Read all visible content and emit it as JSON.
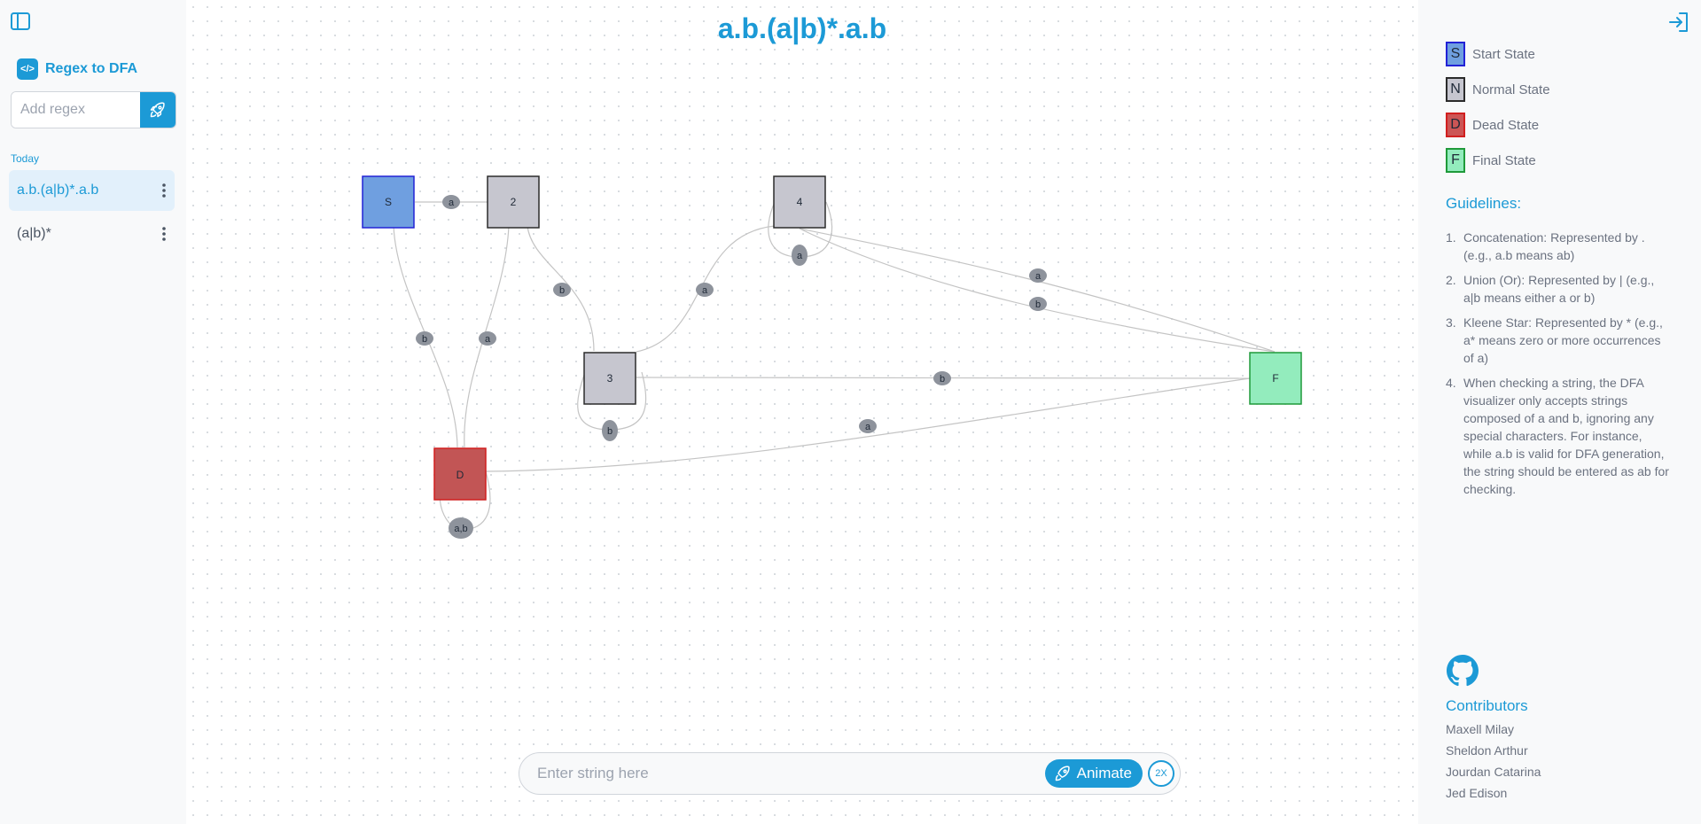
{
  "sidebar": {
    "app_name": "Regex to DFA",
    "logo_text": "</>",
    "regex_placeholder": "Add regex",
    "section_label": "Today",
    "history": [
      {
        "label": "a.b.(a|b)*.a.b",
        "active": true
      },
      {
        "label": "(a|b)*",
        "active": false
      }
    ]
  },
  "main": {
    "title": "a.b.(a|b)*.a.b",
    "string_placeholder": "Enter string here",
    "animate_label": "Animate",
    "speed_label": "2X"
  },
  "dfa": {
    "states": [
      {
        "id": "S",
        "type": "start"
      },
      {
        "id": "2",
        "type": "normal"
      },
      {
        "id": "4",
        "type": "normal"
      },
      {
        "id": "3",
        "type": "normal"
      },
      {
        "id": "D",
        "type": "dead"
      },
      {
        "id": "F",
        "type": "final"
      }
    ],
    "transitions": [
      {
        "from": "S",
        "to": "2",
        "label": "a"
      },
      {
        "from": "S",
        "to": "D",
        "label": "b"
      },
      {
        "from": "2",
        "to": "D",
        "label": "a"
      },
      {
        "from": "2",
        "to": "3",
        "label": "b"
      },
      {
        "from": "3",
        "to": "4",
        "label": "a"
      },
      {
        "from": "3",
        "to": "3",
        "label": "b"
      },
      {
        "from": "4",
        "to": "4",
        "label": "a"
      },
      {
        "from": "4",
        "to": "F",
        "label": "a"
      },
      {
        "from": "4",
        "to": "F",
        "label": "b"
      },
      {
        "from": "3",
        "to": "F",
        "label": "b"
      },
      {
        "from": "D",
        "to": "F",
        "label": "a"
      },
      {
        "from": "D",
        "to": "D",
        "label": "a,b"
      }
    ]
  },
  "legend": [
    {
      "letter": "S",
      "label": "Start State",
      "fill": "#6f9fe0",
      "border": "#2222d6"
    },
    {
      "letter": "N",
      "label": "Normal State",
      "fill": "#c6c6cf",
      "border": "#2b2b2b"
    },
    {
      "letter": "D",
      "label": "Dead State",
      "fill": "#cc5555",
      "border": "#d11f1f"
    },
    {
      "letter": "F",
      "label": "Final State",
      "fill": "#93ecbd",
      "border": "#1f9a3a"
    }
  ],
  "guidelines": {
    "title": "Guidelines:",
    "items": [
      {
        "num": "1.",
        "text": "Concatenation: Represented by . (e.g., a.b means ab)"
      },
      {
        "num": "2.",
        "text": "Union (Or): Represented by | (e.g., a|b means either a or b)"
      },
      {
        "num": "3.",
        "text": "Kleene Star: Represented by * (e.g., a* means zero or more occurrences of a)"
      },
      {
        "num": "4.",
        "text": "When checking a string, the DFA visualizer only accepts strings composed of a and b, ignoring any special characters. For instance, while a.b is valid for DFA generation, the string should be entered as ab for checking."
      }
    ]
  },
  "contributors": {
    "title": "Contributors",
    "names": [
      "Maxell Milay",
      "Sheldon Arthur",
      "Jourdan Catarina",
      "Jed Edison"
    ]
  },
  "icons": {
    "sidebar_toggle": "sidebar-toggle-icon",
    "rocket": "rocket-icon",
    "kebab": "more-vertical-icon",
    "exit": "log-in-icon",
    "github": "github-icon"
  },
  "colors": {
    "accent": "#1c9ad6",
    "edge": "#c4c4c4",
    "edge_label_bg": "#8e939c"
  }
}
